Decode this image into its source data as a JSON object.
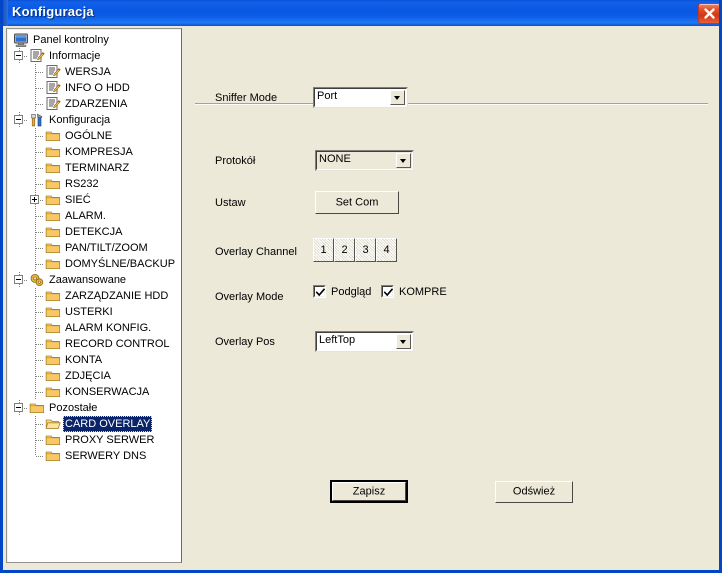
{
  "window": {
    "title": "Konfiguracja",
    "close_icon": "close-icon",
    "accent_color": "#0a58e2",
    "face_color": "#ece9d8",
    "selection_color": "#0a246a"
  },
  "tree": {
    "items": [
      {
        "label": "Panel kontrolny",
        "icon": "monitor-icon",
        "depth": 0,
        "expander": "none",
        "selected": false
      },
      {
        "label": "Informacje",
        "icon": "notepad-icon",
        "depth": 1,
        "expander": "minus",
        "selected": false
      },
      {
        "label": "WERSJA",
        "icon": "notepad-icon",
        "depth": 2,
        "expander": "none",
        "selected": false
      },
      {
        "label": "INFO O HDD",
        "icon": "notepad-icon",
        "depth": 2,
        "expander": "none",
        "selected": false
      },
      {
        "label": "ZDARZENIA",
        "icon": "notepad-icon",
        "depth": 2,
        "expander": "none",
        "selected": false
      },
      {
        "label": "Konfiguracja",
        "icon": "tools-icon",
        "depth": 1,
        "expander": "minus",
        "selected": false
      },
      {
        "label": "OGÓLNE",
        "icon": "folder-icon",
        "depth": 2,
        "expander": "none",
        "selected": false
      },
      {
        "label": "KOMPRESJA",
        "icon": "folder-icon",
        "depth": 2,
        "expander": "none",
        "selected": false
      },
      {
        "label": "TERMINARZ",
        "icon": "folder-icon",
        "depth": 2,
        "expander": "none",
        "selected": false
      },
      {
        "label": "RS232",
        "icon": "folder-icon",
        "depth": 2,
        "expander": "none",
        "selected": false
      },
      {
        "label": "SIEĆ",
        "icon": "folder-icon",
        "depth": 2,
        "expander": "plus",
        "selected": false
      },
      {
        "label": "ALARM.",
        "icon": "folder-icon",
        "depth": 2,
        "expander": "none",
        "selected": false
      },
      {
        "label": "DETEKCJA",
        "icon": "folder-icon",
        "depth": 2,
        "expander": "none",
        "selected": false
      },
      {
        "label": "PAN/TILT/ZOOM",
        "icon": "folder-icon",
        "depth": 2,
        "expander": "none",
        "selected": false
      },
      {
        "label": "DOMYŚLNE/BACKUP",
        "icon": "folder-icon",
        "depth": 2,
        "expander": "none",
        "selected": false
      },
      {
        "label": "Zaawansowane",
        "icon": "gears-icon",
        "depth": 1,
        "expander": "minus",
        "selected": false
      },
      {
        "label": "ZARZĄDZANIE HDD",
        "icon": "folder-icon",
        "depth": 2,
        "expander": "none",
        "selected": false
      },
      {
        "label": "USTERKI",
        "icon": "folder-icon",
        "depth": 2,
        "expander": "none",
        "selected": false
      },
      {
        "label": "ALARM KONFIG.",
        "icon": "folder-icon",
        "depth": 2,
        "expander": "none",
        "selected": false
      },
      {
        "label": "RECORD CONTROL",
        "icon": "folder-icon",
        "depth": 2,
        "expander": "none",
        "selected": false
      },
      {
        "label": "KONTA",
        "icon": "folder-icon",
        "depth": 2,
        "expander": "none",
        "selected": false
      },
      {
        "label": "ZDJĘCIA",
        "icon": "folder-icon",
        "depth": 2,
        "expander": "none",
        "selected": false
      },
      {
        "label": "KONSERWACJA",
        "icon": "folder-icon",
        "depth": 2,
        "expander": "none",
        "selected": false
      },
      {
        "label": "Pozostałe",
        "icon": "folder-icon",
        "depth": 1,
        "expander": "minus",
        "selected": false
      },
      {
        "label": "CARD OVERLAY",
        "icon": "folder-open-icon",
        "depth": 2,
        "expander": "none",
        "selected": true
      },
      {
        "label": "PROXY SERWER",
        "icon": "folder-icon",
        "depth": 2,
        "expander": "none",
        "selected": false
      },
      {
        "label": "SERWERY DNS",
        "icon": "folder-icon",
        "depth": 2,
        "expander": "none",
        "selected": false
      }
    ]
  },
  "form": {
    "sniffer_mode": {
      "label": "Sniffer Mode",
      "value": "Port"
    },
    "protocol": {
      "label": "Protokół",
      "value": "NONE"
    },
    "set_com": {
      "label": "Ustaw",
      "button_label": "Set Com"
    },
    "overlay_channel": {
      "label": "Overlay Channel",
      "channels": [
        "1",
        "2",
        "3",
        "4"
      ]
    },
    "overlay_mode": {
      "label": "Overlay Mode",
      "checkboxes": [
        {
          "label": "Podgląd",
          "checked": true
        },
        {
          "label": "KOMPRE",
          "checked": true
        }
      ]
    },
    "overlay_pos": {
      "label": "Overlay Pos",
      "value": "LeftTop"
    }
  },
  "actions": {
    "save_label": "Zapisz",
    "refresh_label": "Odśwież"
  }
}
